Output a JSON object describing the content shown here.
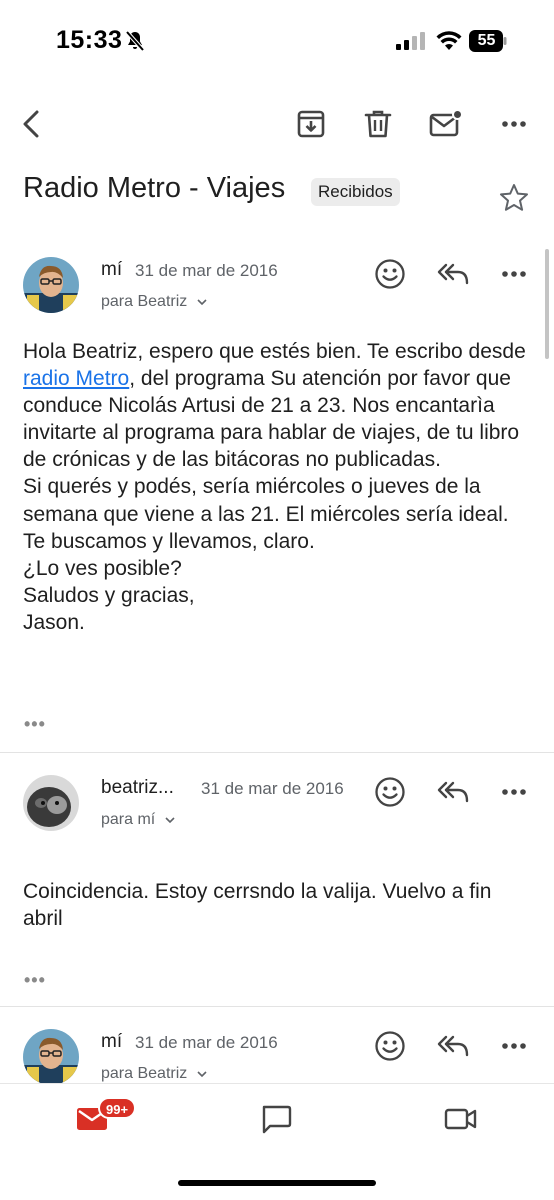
{
  "status_bar": {
    "time": "15:33",
    "battery": "55",
    "icons": [
      "bell-slash-icon",
      "cellular-signal-icon",
      "wifi-icon",
      "battery-icon"
    ]
  },
  "toolbar": {
    "icons": [
      "back-arrow-icon",
      "archive-icon",
      "trash-icon",
      "mark-unread-icon",
      "more-vert-icon"
    ]
  },
  "thread": {
    "subject": "Radio Metro - Viajes",
    "label": "Recibidos"
  },
  "messages": [
    {
      "sender": "mí",
      "date": "31 de mar de 2016",
      "recipient": "para Beatriz",
      "body": {
        "line1_before_link": "Hola Beatriz, espero que estés bien. Te escribo desde ",
        "link_text": "radio Metro",
        "line1_after_link": ", del programa Su atención por favor que conduce Nicolás Artusi de 21 a 23. Nos encantarìa invitarte al programa para hablar de viajes, de tu libro de crónicas y de las bitácoras no publicadas.",
        "p2": "Si querés y podés, sería miércoles o jueves de la semana que viene a las 21. El miércoles sería ideal.",
        "p3": "Te buscamos y llevamos, claro.",
        "p4": "¿Lo ves posible?",
        "p5": "Saludos y gracias,",
        "p6": "Jason."
      },
      "ellipsis": "•••"
    },
    {
      "sender": "beatriz...",
      "date": "31 de mar de 2016",
      "recipient": "para mí",
      "body": "Coincidencia. Estoy cerrsndo la valija. Vuelvo a fin abril",
      "ellipsis": "•••"
    },
    {
      "sender": "mí",
      "date": "31 de mar de 2016",
      "recipient": "para Beatriz"
    }
  ],
  "bottom_nav": {
    "mail_badge": "99+",
    "items": [
      "mail-icon",
      "chat-icon",
      "meet-video-icon"
    ]
  },
  "colors": {
    "link": "#1a73e8",
    "badge": "#d93025",
    "secondary_text": "#5f6368"
  }
}
